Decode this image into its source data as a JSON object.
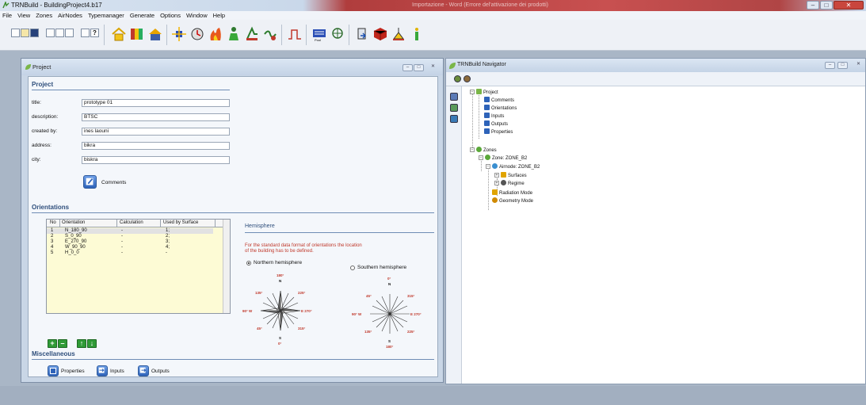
{
  "app": {
    "title": "TRNBuild - BuildingProject4.b17",
    "faded_title": "Importazione - Word (Errore del'attivazione dei prodotti)"
  },
  "menu": [
    "File",
    "View",
    "Zones",
    "AirNodes",
    "Typemanager",
    "Generate",
    "Options",
    "Window",
    "Help"
  ],
  "project_window": {
    "title": "Project",
    "project_section": "Project",
    "fields": [
      {
        "label": "title:",
        "value": "prototype 01"
      },
      {
        "label": "description:",
        "value": "BTSC"
      },
      {
        "label": "created by:",
        "value": "ines laouni"
      },
      {
        "label": "address:",
        "value": "bikra"
      },
      {
        "label": "city:",
        "value": "biskra"
      }
    ],
    "comments_label": "Comments",
    "orientations_section": "Orientations",
    "table": {
      "headers": [
        "No",
        "Orientation",
        "Calculation",
        "Used by Surface"
      ],
      "rows": [
        [
          "1",
          "N_180_90",
          "-",
          "1;"
        ],
        [
          "2",
          "S_0_90",
          "-",
          "2;"
        ],
        [
          "3",
          "E_270_90",
          "-",
          "3;"
        ],
        [
          "4",
          "W_90_90",
          "-",
          "4;"
        ],
        [
          "5",
          "H_0_0",
          "-",
          "-"
        ]
      ]
    },
    "hemisphere": {
      "heading": "Hemisphere",
      "note_line1": "For the standard data format of orientations the location",
      "note_line2": "of the building has to be defined.",
      "northern": "Northern hemisphere",
      "southern": "Southern hemisphere",
      "selected": "Northern hemisphere",
      "compass_north": {
        "top": "180°",
        "top2": "N",
        "bottom": "0°",
        "bottom2": "S",
        "left": "90° W",
        "right": "E 270°",
        "ne": "225°",
        "nw": "135°",
        "se": "315°",
        "sw": "45°"
      },
      "compass_south": {
        "top": "0°",
        "top2": "N",
        "bottom": "180°",
        "bottom2": "S",
        "left": "90° W",
        "right": "E 270°",
        "ne": "315°",
        "nw": "45°",
        "se": "225°",
        "sw": "135°"
      }
    },
    "misc_section": "Miscellaneous",
    "misc_buttons": [
      "Properties",
      "Inputs",
      "Outputs"
    ]
  },
  "navigator": {
    "title": "TRNBuild Navigator",
    "tree": {
      "project": "Project",
      "project_children": [
        "Comments",
        "Orientations",
        "Inputs",
        "Outputs",
        "Properties"
      ],
      "zones": "Zones",
      "zone": "Zone: ZONE_B2",
      "airnode": "Airnode: ZONE_B2",
      "airnode_children": [
        "Surfaces",
        "Regime"
      ],
      "zone_children": [
        "Radiation Mode",
        "Geometry Mode"
      ]
    }
  }
}
